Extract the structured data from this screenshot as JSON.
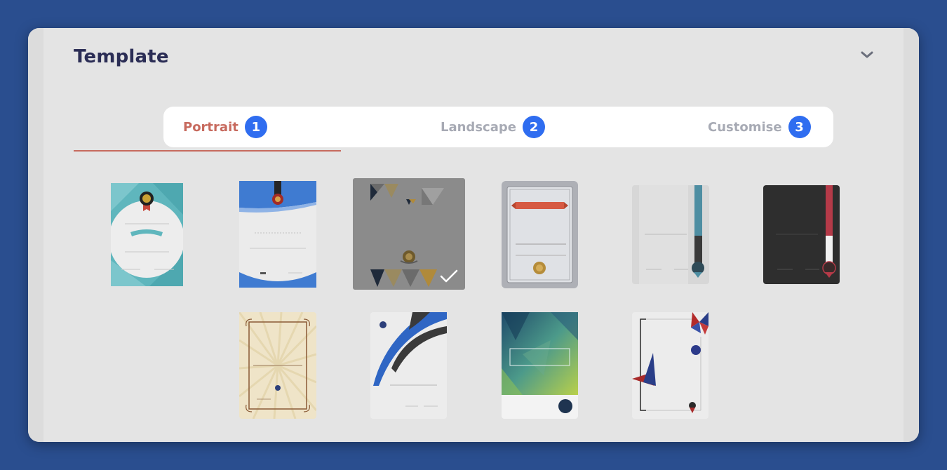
{
  "panel": {
    "title": "Template"
  },
  "tabs": [
    {
      "label": "Portrait",
      "number": "1",
      "active": true
    },
    {
      "label": "Landscape",
      "number": "2",
      "active": false
    },
    {
      "label": "Customise",
      "number": "3",
      "active": false
    }
  ],
  "templates": [
    {
      "style": "teal-ribbon"
    },
    {
      "style": "blue-wave"
    },
    {
      "style": "triangles",
      "selected": true
    },
    {
      "style": "silver-frame"
    },
    {
      "style": "grey-blue-sash"
    },
    {
      "style": "dark-red-sash"
    },
    {
      "style": "vintage-sunburst"
    },
    {
      "style": "blue-swoosh"
    },
    {
      "style": "polygon-gradient"
    },
    {
      "style": "geometric-corners"
    }
  ],
  "colors": {
    "background": "#2a4e8f",
    "panel": "#e4e4e4",
    "active_tab": "#c76a5e",
    "inactive_tab": "#a7aab4",
    "badge": "#2f6df0"
  },
  "icons": {
    "collapse": "chevron-down-icon",
    "selected": "checkmark-icon"
  }
}
